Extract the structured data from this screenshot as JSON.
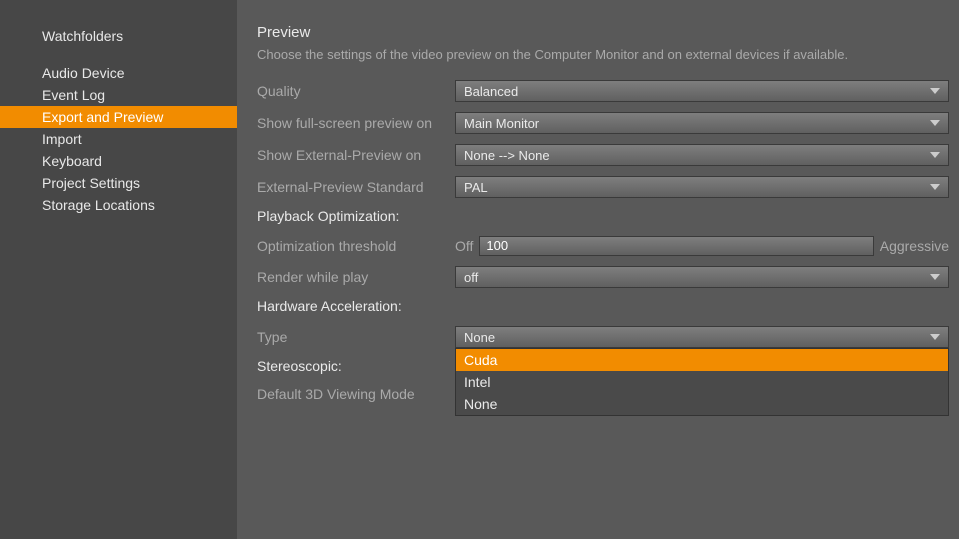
{
  "sidebar": {
    "heading": "Watchfolders",
    "items": [
      {
        "label": "Audio Device",
        "active": false
      },
      {
        "label": "Event Log",
        "active": false
      },
      {
        "label": "Export and Preview",
        "active": true
      },
      {
        "label": "Import",
        "active": false
      },
      {
        "label": "Keyboard",
        "active": false
      },
      {
        "label": "Project Settings",
        "active": false
      },
      {
        "label": "Storage Locations",
        "active": false
      }
    ]
  },
  "panel": {
    "title": "Preview",
    "description": "Choose the settings of the video preview on the Computer Monitor and on external devices if available.",
    "quality": {
      "label": "Quality",
      "value": "Balanced"
    },
    "fullscreen": {
      "label": "Show full-screen preview on",
      "value": "Main Monitor"
    },
    "external_preview": {
      "label": "Show External-Preview on",
      "value": "None --> None"
    },
    "external_std": {
      "label": "External-Preview Standard",
      "value": "PAL"
    },
    "playback_section": "Playback Optimization:",
    "opt_threshold": {
      "label": "Optimization threshold",
      "left": "Off",
      "value": "100",
      "right": "Aggressive"
    },
    "render_while_play": {
      "label": "Render while play",
      "value": "off"
    },
    "hw_section": "Hardware Acceleration:",
    "type": {
      "label": "Type",
      "value": "None",
      "options": [
        {
          "label": "Cuda",
          "highlighted": true
        },
        {
          "label": "Intel",
          "highlighted": false
        },
        {
          "label": "None",
          "highlighted": false
        }
      ]
    },
    "stereo_section": "Stereoscopic:",
    "default_3d": {
      "label": "Default 3D Viewing Mode"
    }
  }
}
